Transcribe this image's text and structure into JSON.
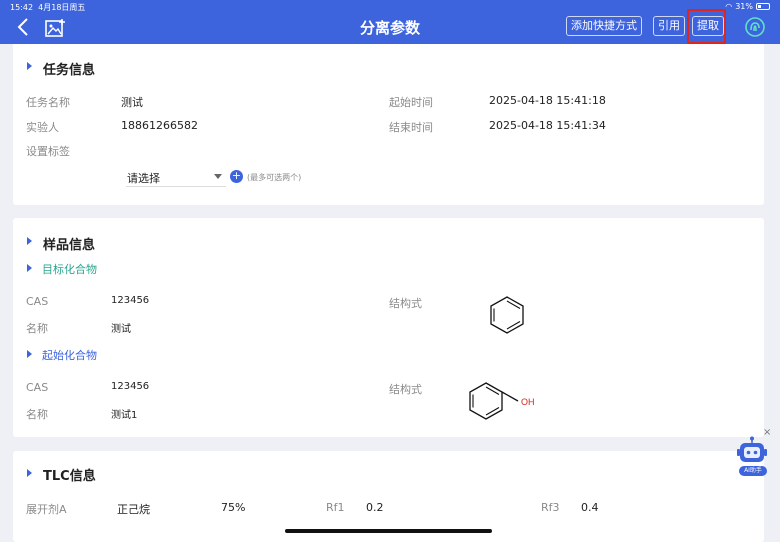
{
  "statusbar": {
    "time": "15:42",
    "date": "4月18日周五",
    "battery": "31%"
  },
  "header": {
    "title": "分离参数",
    "shortcut_label": "添加快捷方式",
    "quote_label": "引用",
    "extract_label": "提取",
    "accent": "#3d63dd",
    "highlight_color": "#e1241c"
  },
  "task": {
    "title": "任务信息",
    "name_label": "任务名称",
    "name_value": "测试",
    "person_label": "实验人",
    "person_value": "18861266582",
    "tag_label": "设置标签",
    "start_label": "起始时间",
    "start_value": "2025-04-18 15:41:18",
    "end_label": "结束时间",
    "end_value": "2025-04-18 15:41:34",
    "select_value": "请选择",
    "select_hint": "(最多可选两个)"
  },
  "sample": {
    "title": "样品信息",
    "target": {
      "title": "目标化合物",
      "cas_label": "CAS",
      "cas_value": "123456",
      "name_label": "名称",
      "name_value": "测试",
      "struct_label": "结构式"
    },
    "start": {
      "title": "起始化合物",
      "cas_label": "CAS",
      "cas_value": "123456",
      "name_label": "名称",
      "name_value": "测试1",
      "struct_label": "结构式",
      "struct_oh": "OH"
    }
  },
  "tlc": {
    "title": "TLC信息",
    "solvent_label": "展开剂A",
    "solvent_value": "正己烷",
    "percent": "75%",
    "rf1_label": "Rf1",
    "rf1_value": "0.2",
    "rf3_label": "Rf3",
    "rf3_value": "0.4"
  },
  "ai": {
    "label": "AI助手",
    "close": "×"
  }
}
